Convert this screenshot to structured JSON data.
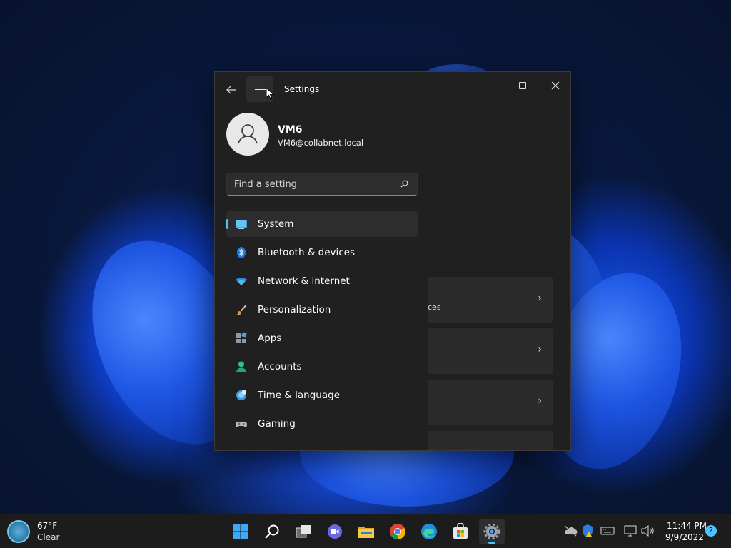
{
  "window": {
    "title": "Settings",
    "back_icon": "back-arrow-icon",
    "menu_icon": "hamburger-menu-icon"
  },
  "user": {
    "name": "VM6",
    "email": "VM6@collabnet.local"
  },
  "search": {
    "placeholder": "Find a setting"
  },
  "nav": {
    "items": [
      {
        "label": "System",
        "icon": "system-display-icon",
        "active": true
      },
      {
        "label": "Bluetooth & devices",
        "icon": "bluetooth-icon"
      },
      {
        "label": "Network & internet",
        "icon": "wifi-icon"
      },
      {
        "label": "Personalization",
        "icon": "paintbrush-icon"
      },
      {
        "label": "Apps",
        "icon": "apps-icon"
      },
      {
        "label": "Accounts",
        "icon": "person-icon"
      },
      {
        "label": "Time & language",
        "icon": "globe-clock-icon"
      },
      {
        "label": "Gaming",
        "icon": "gamepad-icon"
      }
    ]
  },
  "content": {
    "card1_text": "ces"
  },
  "taskbar": {
    "weather": {
      "temp": "67°F",
      "condition": "Clear"
    },
    "clock": {
      "time": "11:44 PM",
      "date": "9/9/2022"
    },
    "notifications": "2"
  },
  "colors": {
    "accent": "#4cc2ff",
    "window_bg": "#202020",
    "taskbar_bg": "#1c1c1c"
  }
}
